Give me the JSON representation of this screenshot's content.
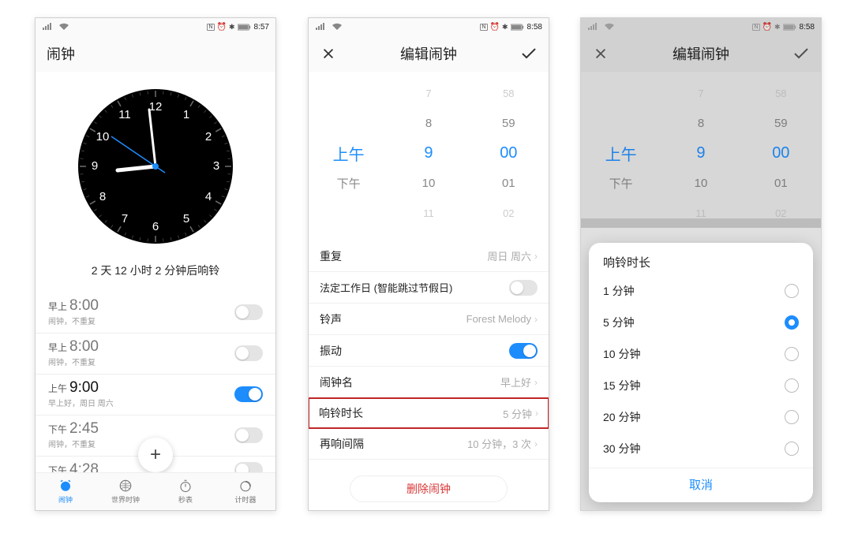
{
  "s1": {
    "status_time": "8:57",
    "title": "闹钟",
    "countdown": "2 天 12 小时 2 分钟后响铃",
    "alarms": [
      {
        "ampm": "早上",
        "hm": "8:00",
        "sub": "闹钟，不重复",
        "on": false
      },
      {
        "ampm": "早上",
        "hm": "8:00",
        "sub": "闹钟，不重复",
        "on": false
      },
      {
        "ampm": "上午",
        "hm": "9:00",
        "sub": "早上好，周日 周六",
        "on": true
      },
      {
        "ampm": "下午",
        "hm": "2:45",
        "sub": "闹钟，不重复",
        "on": false
      },
      {
        "ampm": "下午",
        "hm": "4:28",
        "sub": "",
        "on": false
      }
    ],
    "tabs": [
      "闹钟",
      "世界时钟",
      "秒表",
      "计时器"
    ]
  },
  "s2": {
    "status_time": "8:58",
    "title": "编辑闹钟",
    "picker": {
      "am": "上午",
      "pm": "下午",
      "rows": [
        {
          "ampm": "",
          "h": "7",
          "m": "58",
          "cls": "dim"
        },
        {
          "ampm": "",
          "h": "8",
          "m": "59",
          "cls": "semi"
        },
        {
          "ampm": "上午",
          "h": "9",
          "m": "00",
          "cls": "sel"
        },
        {
          "ampm": "下午",
          "h": "10",
          "m": "01",
          "cls": "semi"
        },
        {
          "ampm": "",
          "h": "11",
          "m": "02",
          "cls": "dim"
        }
      ]
    },
    "settings": {
      "repeat_label": "重复",
      "repeat_val": "周日 周六",
      "workday_label": "法定工作日 (智能跳过节假日)",
      "ringtone_label": "铃声",
      "ringtone_val": "Forest Melody",
      "vibrate_label": "振动",
      "name_label": "闹钟名",
      "name_val": "早上好",
      "duration_label": "响铃时长",
      "duration_val": "5 分钟",
      "snooze_label": "再响间隔",
      "snooze_val": "10 分钟，3 次"
    },
    "delete": "删除闹钟"
  },
  "s3": {
    "status_time": "8:58",
    "title": "编辑闹钟",
    "modal_title": "响铃时长",
    "options": [
      {
        "label": "1 分钟",
        "on": false
      },
      {
        "label": "5 分钟",
        "on": true
      },
      {
        "label": "10 分钟",
        "on": false
      },
      {
        "label": "15 分钟",
        "on": false
      },
      {
        "label": "20 分钟",
        "on": false
      },
      {
        "label": "30 分钟",
        "on": false
      }
    ],
    "cancel": "取消"
  }
}
